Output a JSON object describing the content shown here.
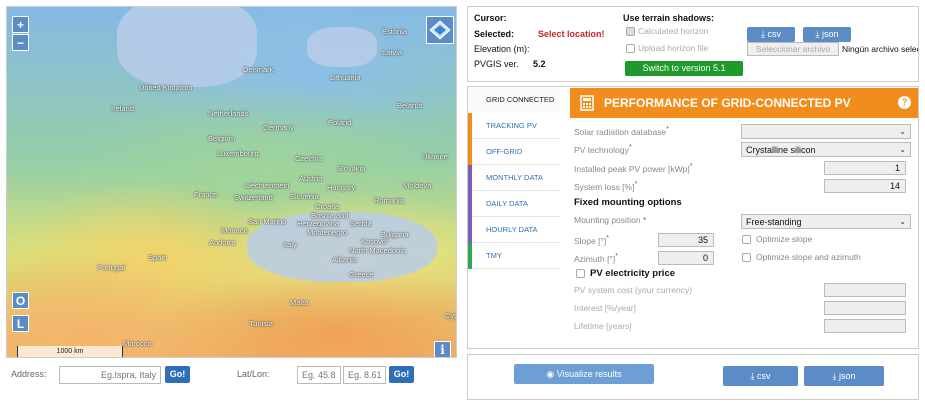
{
  "map": {
    "labels": {
      "estonia": "Estonia",
      "latvia": "Latvia",
      "lithuania": "Lithuania",
      "denmark": "Denmark",
      "uk": "United Kingdom",
      "ireland": "Ireland",
      "netherlands": "Netherlands",
      "belarus": "Belarus",
      "germany": "Germany",
      "poland": "Poland",
      "belgium": "Belgium",
      "luxembourg": "Luxembourg",
      "czechia": "Czechia",
      "ukraine": "Ukraine",
      "slovakia": "Slovakia",
      "austria": "Austria",
      "liechtenstein": "Liechtenstein",
      "hungary": "Hungary",
      "moldova": "Moldova",
      "france": "France",
      "switzerland": "Switzerland",
      "slovenia": "Slovenia",
      "romania": "Romania",
      "croatia": "Croatia",
      "bosnia": "Bosnia and",
      "herzegovina": "Herzegovina",
      "serbia": "Serbia",
      "sanmarino": "San Marino",
      "monaco": "Monaco",
      "montenegro": "Montenegro",
      "bulgaria": "Bulgaria",
      "andorra": "Andorra",
      "italy": "Italy",
      "kosovo": "Kosovo*",
      "northmacedonia": "North Macedonia",
      "spain": "Spain",
      "portugal": "Portugal",
      "albania": "Albania",
      "greece": "Greece",
      "malta": "Malta",
      "tunisia": "Tunisia",
      "morocco": "Morocco",
      "cyprus": "Cypr"
    },
    "zoom_in": "+",
    "zoom_out": "−",
    "btn_o": "O",
    "btn_l": "L",
    "btn_i": "i",
    "scale": "1000 km"
  },
  "address": {
    "label": "Address:",
    "placeholder": "Eg.Ispra, Italy",
    "go": "Go!",
    "latlon_label": "Lat/Lon:",
    "lat_placeholder": "Eg. 45.81",
    "lon_placeholder": "Eg. 8.611",
    "go2": "Go!"
  },
  "info": {
    "cursor": "Cursor:",
    "selected": "Selected:",
    "selected_value": "Select location!",
    "elevation": "Elevation (m):",
    "pvgis": "PVGIS ver.",
    "pvgis_value": "5.2",
    "terrain_title": "Use terrain shadows:",
    "calc_horizon": "Calculated horizon",
    "upload_horizon": "Upload horizon file",
    "switch": "Switch to version 5.1",
    "csv": "csv",
    "json": "json",
    "choose_file": "Seleccionar archivo",
    "no_file": "Ningún archivo seleccionado"
  },
  "tabs": [
    {
      "label": "GRID CONNECTED",
      "color": "#ffffff"
    },
    {
      "label": "TRACKING PV",
      "color": "#f28c1c"
    },
    {
      "label": "OFF-GRID",
      "color": "#f28c1c"
    },
    {
      "label": "MONTHLY DATA",
      "color": "#7b5bb5"
    },
    {
      "label": "DAILY DATA",
      "color": "#7b5bb5"
    },
    {
      "label": "HOURLY DATA",
      "color": "#7b5bb5"
    },
    {
      "label": "TMY",
      "color": "#2fa84f"
    }
  ],
  "panel": {
    "title": "PERFORMANCE OF GRID-CONNECTED PV",
    "help": "?",
    "solar_db": "Solar radiation database",
    "pv_tech": "PV technology",
    "pv_tech_value": "Crystalline silicon",
    "peak_power": "Installed peak PV power [kWp]",
    "peak_value": "1",
    "system_loss": "System loss [%]",
    "loss_value": "14",
    "fixed_title": "Fixed mounting options",
    "mounting": "Mounting position",
    "mounting_value": "Free-standing",
    "slope": "Slope [°]",
    "slope_value": "35",
    "optimize_slope": "Optimize slope",
    "azimuth": "Azimuth [°]",
    "azimuth_value": "0",
    "optimize_both": "Optimize slope and azimuth",
    "price_title": "PV electricity price",
    "system_cost": "PV system cost (your currency)",
    "interest": "Interest [%/year]",
    "lifetime": "Lifetime [years]"
  },
  "bottom": {
    "visualize": "Visualize results",
    "csv": "csv",
    "json": "json"
  },
  "colors": {
    "orange": "#f28c1c",
    "blue": "#2e6fb7",
    "green": "#1e9a2a",
    "red": "#c0272d"
  }
}
